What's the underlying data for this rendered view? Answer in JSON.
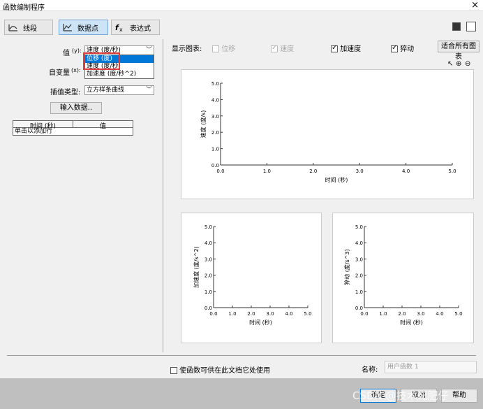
{
  "window": {
    "title": "函数编制程序",
    "close": "×"
  },
  "toolbar": {
    "tab_segment": "线段",
    "tab_datapoints": "数据点",
    "tab_expression": "表达式"
  },
  "left": {
    "value_label": "值",
    "value_unit": "(y):",
    "value_selected": "速度 (度/秒)",
    "value_options": [
      "位移 (度)",
      "速度 (度/秒)",
      "加速度 (度/秒^2)"
    ],
    "indep_label": "自变量",
    "indep_unit": "(x):",
    "interp_label": "插值类型:",
    "interp_selected": "立方样条曲线",
    "input_button": "输入数据..",
    "grid_col_time": "时间 (秒)",
    "grid_col_value": "值",
    "grid_add_row": "单击以添加行"
  },
  "display": {
    "label": "显示图表:",
    "opt_disp": "位移",
    "opt_vel": "速度",
    "opt_acc": "加速度",
    "opt_jerk": "猝动",
    "fit_button": "适合所有图表"
  },
  "charts": {
    "vel": {
      "ylabel": "速度 (度/s)",
      "xlabel": "时间 (秒)"
    },
    "acc": {
      "ylabel": "加速度 (度/s^2)",
      "xlabel": "时间 (秒)"
    },
    "jerk": {
      "ylabel": "猝动 (度/s^3)",
      "xlabel": "时间 (秒)"
    }
  },
  "chart_data": [
    {
      "type": "line",
      "title": "",
      "xlabel": "时间 (秒)",
      "ylabel": "速度 (度/s)",
      "xlim": [
        0,
        5
      ],
      "ylim": [
        0,
        5
      ],
      "xticks": [
        "0.0",
        "1.0",
        "2.0",
        "3.0",
        "4.0",
        "5.0"
      ],
      "yticks": [
        "0.0",
        "1.0",
        "2.0",
        "3.0",
        "4.0",
        "5.0"
      ],
      "series": []
    },
    {
      "type": "line",
      "title": "",
      "xlabel": "时间 (秒)",
      "ylabel": "加速度 (度/s^2)",
      "xlim": [
        0,
        5
      ],
      "ylim": [
        0,
        5
      ],
      "xticks": [
        "0.0",
        "1.0",
        "2.0",
        "3.0",
        "4.0",
        "5.0"
      ],
      "yticks": [
        "0.0",
        "1.0",
        "2.0",
        "3.0",
        "4.0",
        "5.0"
      ],
      "series": []
    },
    {
      "type": "line",
      "title": "",
      "xlabel": "时间 (秒)",
      "ylabel": "猝动 (度/s^3)",
      "xlim": [
        0,
        5
      ],
      "ylim": [
        0,
        5
      ],
      "xticks": [
        "0.0",
        "1.0",
        "2.0",
        "3.0",
        "4.0",
        "5.0"
      ],
      "yticks": [
        "0.0",
        "1.0",
        "2.0",
        "3.0",
        "4.0",
        "5.0"
      ],
      "series": []
    }
  ],
  "bottom": {
    "share_label": "使函数可供在此文档它处使用",
    "name_label": "名称:",
    "name_value": "用户函数 1",
    "ok": "确定",
    "cancel": "取消",
    "help": "帮助",
    "watermark": "CSDN @技术死肥仔"
  },
  "colors": {
    "selection": "#0078d7",
    "highlight_box": "#e23b3b",
    "tab_selected": "#cde4f7"
  }
}
